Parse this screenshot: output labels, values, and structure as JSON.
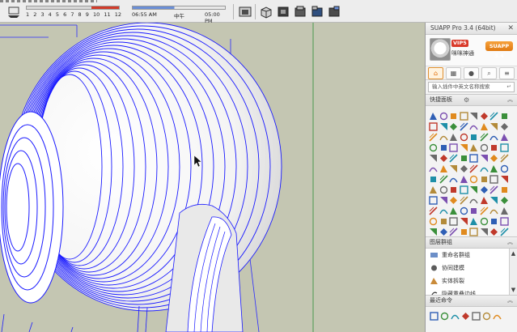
{
  "toolbar": {
    "months": [
      "1",
      "2",
      "3",
      "4",
      "5",
      "6",
      "7",
      "8",
      "9",
      "10",
      "11",
      "12"
    ],
    "time_start": "06:55 AM",
    "time_mid": "中午",
    "time_end": "05:00 PM"
  },
  "panel": {
    "title": "SUAPP Pro 3.4 (64bit)",
    "vip_label": "VIP5",
    "user_name": "咪咪神通",
    "suapp_button": "SUAPP 3.4",
    "search_placeholder": "输入插件中英文名称搜索",
    "quick_panel_label": "快捷面板",
    "group_label": "图层群组",
    "group_items": [
      "重命名群组",
      "协同建模",
      "实体拆裂",
      "隐藏重叠边线"
    ],
    "recent_label": "最近命令"
  },
  "colors": {
    "viewport_bg": "#c4c6b2",
    "wire_blue": "#1a1aff",
    "accent_orange": "#e07a12",
    "vip_red": "#d93a2a"
  }
}
